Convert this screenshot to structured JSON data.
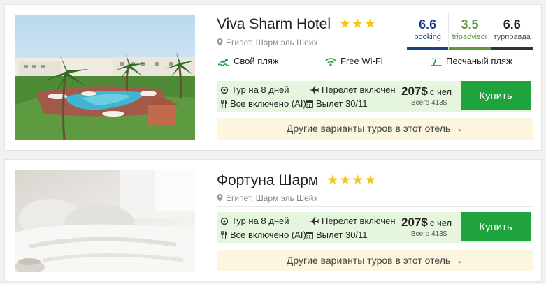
{
  "hotels": [
    {
      "name": "Viva Sharm Hotel",
      "stars": "★★★",
      "location": "Египет, Шарм эль Шейх",
      "ratings": [
        {
          "score": "6.6",
          "source": "booking"
        },
        {
          "score": "3.5",
          "source": "tripadvisor"
        },
        {
          "score": "6.6",
          "source": "турправда"
        }
      ],
      "amenities": [
        "Свой пляж",
        "Free Wi-Fi",
        "Песчаный пляж"
      ],
      "duration": "Тур на 8 дней",
      "flight": "Перелет включен",
      "meals": "Все включено (AI)",
      "departure": "Вылет 30/11",
      "price": "207$",
      "price_unit": "с чел",
      "total": "Всего 413$",
      "buy_label": "Купить",
      "other_label": "Другие варианты туров в этот отель →"
    },
    {
      "name": "Фортуна Шарм",
      "stars": "★★★★",
      "location": "Египет, Шарм эль Шейх",
      "duration": "Тур на 8 дней",
      "flight": "Перелет включен",
      "meals": "Все включено (AI)",
      "departure": "Вылет 30/11",
      "price": "207$",
      "price_unit": "с чел",
      "total": "Всего 413$",
      "buy_label": "Купить",
      "other_label": "Другие варианты туров в этот отель →"
    }
  ],
  "colors": {
    "buy_button": "#1fa33c",
    "tour_bg": "#e6f5de",
    "other_bg": "#fbf6dd",
    "star": "#f5c518",
    "booking": "#1d3f8a",
    "tripadvisor": "#5a9a3c"
  },
  "icons": [
    "location-pin-icon",
    "swimmer-icon",
    "wifi-icon",
    "palm-beach-icon",
    "clock-gear-icon",
    "plane-icon",
    "fork-knife-icon",
    "calendar-icon"
  ]
}
